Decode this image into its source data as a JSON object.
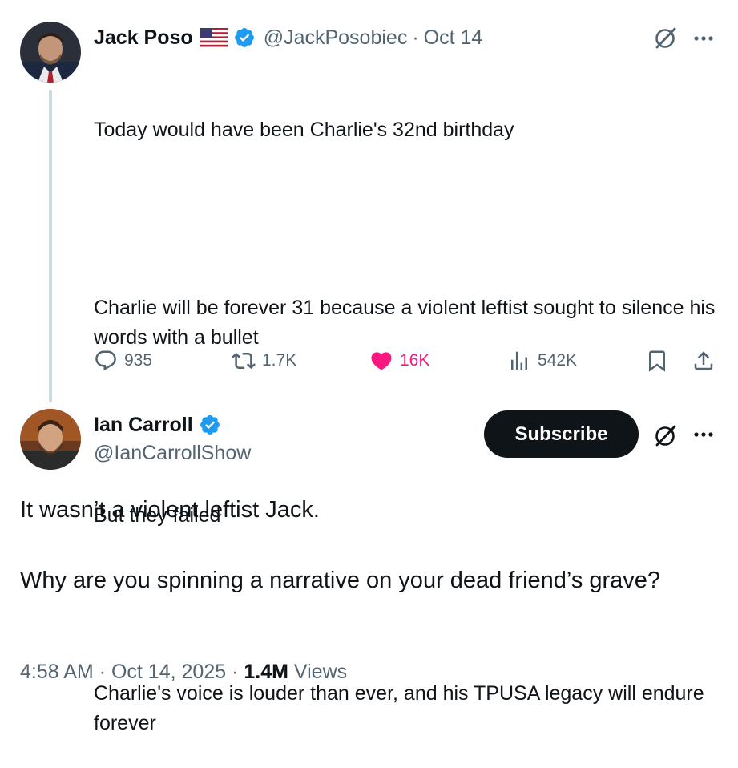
{
  "tweet": {
    "author_name": "Jack Poso",
    "author_flag": "🇺🇸",
    "handle": "@JackPosobiec",
    "separator": "·",
    "date": "Oct 14",
    "paragraphs": [
      "Today would have been Charlie's 32nd birthday",
      "Charlie will be forever 31 because a violent leftist sought to silence his words with a bullet",
      "But they failed",
      "Charlie's voice is louder than ever, and his TPUSA legacy will endure forever"
    ],
    "actions": {
      "replies": "935",
      "reposts": "1.7K",
      "likes": "16K",
      "views": "542K"
    },
    "colors": {
      "like": "#f91880",
      "verified": "#1d9bf0"
    }
  },
  "reply": {
    "author_name": "Ian Carroll",
    "handle": "@IanCarrollShow",
    "subscribe_label": "Subscribe",
    "paragraphs": [
      "It wasn’t a violent leftist Jack.",
      "Why are you spinning a narrative on your dead friend’s grave?"
    ],
    "meta": {
      "time": "4:58 AM",
      "sep1": "·",
      "date": "Oct 14, 2025",
      "sep2": "·",
      "views_count": "1.4M",
      "views_label": "Views"
    }
  },
  "icons": {
    "verified": "verified-badge-icon",
    "grok": "grok-icon",
    "more": "more-icon",
    "reply": "reply-icon",
    "repost": "repost-icon",
    "like": "heart-icon",
    "views": "views-icon",
    "bookmark": "bookmark-icon",
    "share": "share-icon"
  }
}
